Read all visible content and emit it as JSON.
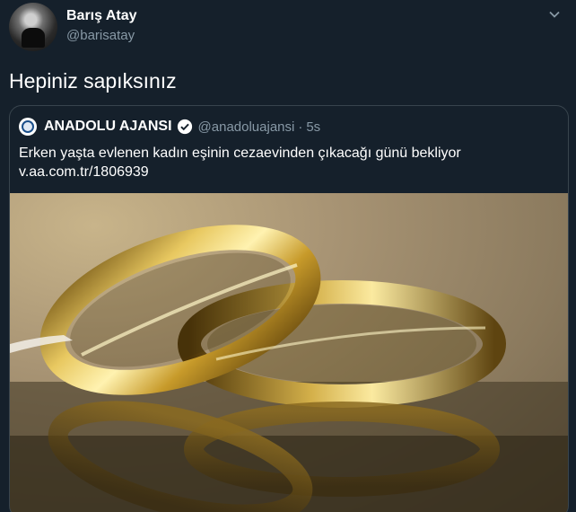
{
  "tweet": {
    "author_name": "Barış Atay",
    "author_handle": "@barisatay",
    "text": "Hepiniz sapıksınız",
    "more_icon": "chevron-down-icon"
  },
  "quoted_tweet": {
    "author_name": "ANADOLU AJANSI",
    "verified": true,
    "author_handle": "@anadoluajansi",
    "separator": "·",
    "time": "5s",
    "text": "Erken yaşta evlenen kadın eşinin cezaevinden çıkacağı günü bekliyor",
    "link": "v.aa.com.tr/1806939",
    "media_icon": "wedding-rings-photo"
  },
  "colors": {
    "background": "#15202b",
    "border": "#38444d",
    "secondary_text": "#8899a6",
    "verified": "#ffffff"
  }
}
